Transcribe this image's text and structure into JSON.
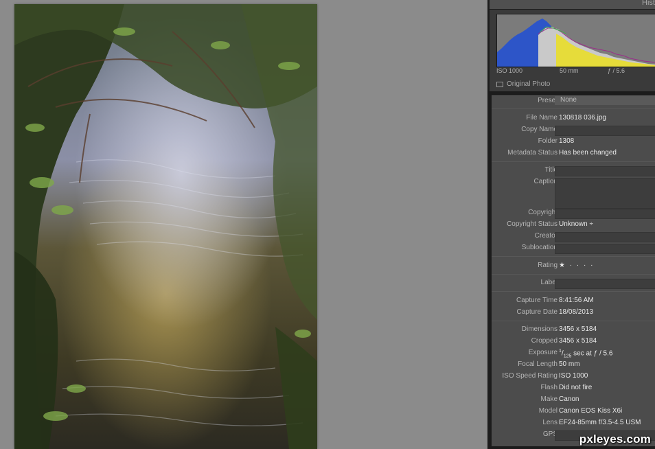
{
  "histogram": {
    "title": "Hist",
    "iso": "ISO 1000",
    "focal": "50 mm",
    "aperture": "ƒ / 5.6",
    "original_photo_label": "Original Photo"
  },
  "metadata": {
    "preset": {
      "label": "Preset",
      "value": "None"
    },
    "file_name": {
      "label": "File Name",
      "value": "130818 036.jpg"
    },
    "copy_name": {
      "label": "Copy Name",
      "value": ""
    },
    "folder": {
      "label": "Folder",
      "value": "1308"
    },
    "metadata_status": {
      "label": "Metadata Status",
      "value": "Has been changed"
    },
    "title": {
      "label": "Title",
      "value": ""
    },
    "caption": {
      "label": "Caption",
      "value": ""
    },
    "copyright": {
      "label": "Copyright",
      "value": ""
    },
    "copyright_status": {
      "label": "Copyright Status",
      "value": "Unknown ÷"
    },
    "creator": {
      "label": "Creator",
      "value": ""
    },
    "sublocation": {
      "label": "Sublocation",
      "value": ""
    },
    "rating": {
      "label": "Rating",
      "value": "★ · · · ·"
    },
    "label": {
      "label": "Label",
      "value": ""
    },
    "capture_time": {
      "label": "Capture Time",
      "value": "8:41:56 AM"
    },
    "capture_date": {
      "label": "Capture Date",
      "value": "18/08/2013"
    },
    "dimensions": {
      "label": "Dimensions",
      "value": "3456 x 5184"
    },
    "cropped": {
      "label": "Cropped",
      "value": "3456 x 5184"
    },
    "exposure": {
      "label": "Exposure",
      "num": "1",
      "den": "125",
      "rest": " sec at ƒ / 5.6"
    },
    "focal_length": {
      "label": "Focal Length",
      "value": "50 mm"
    },
    "iso_speed": {
      "label": "ISO Speed Rating",
      "value": "ISO 1000"
    },
    "flash": {
      "label": "Flash",
      "value": "Did not fire"
    },
    "make": {
      "label": "Make",
      "value": "Canon"
    },
    "model": {
      "label": "Model",
      "value": "Canon EOS Kiss X6i"
    },
    "lens": {
      "label": "Lens",
      "value": "EF24-85mm f/3.5-4.5 USM"
    },
    "gps": {
      "label": "GPS",
      "value": ""
    }
  },
  "watermark": "pxleyes.com",
  "colors": {
    "background": "#8b8b8b",
    "panel": "#4c4c4c",
    "histogram_blue": "#2d55c8",
    "histogram_yellow": "#e6dc3a"
  }
}
